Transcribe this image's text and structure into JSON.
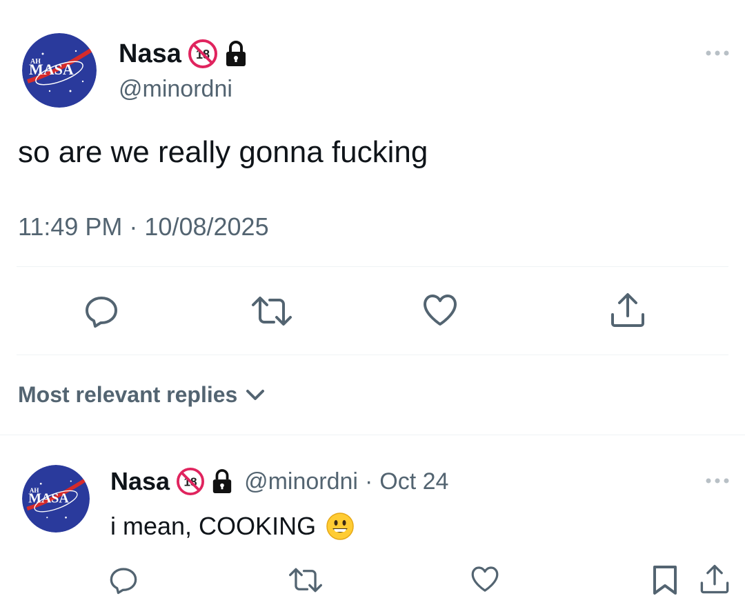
{
  "tweet": {
    "author": {
      "display_name": "Nasa",
      "handle": "@minordni",
      "avatar_text_small": "AH",
      "avatar_text": "MASA",
      "badge_icons": [
        "no-under-18-icon",
        "lock-icon"
      ]
    },
    "text": "so are we really gonna fucking",
    "timestamp": "11:49 PM · 10/08/2025",
    "actions": [
      "reply-icon",
      "retweet-icon",
      "like-icon",
      "share-icon"
    ]
  },
  "replies_header": {
    "label": "Most relevant replies"
  },
  "reply": {
    "author": {
      "display_name": "Nasa",
      "handle": "@minordni",
      "separator": "·",
      "date": "Oct 24",
      "avatar_text_small": "AH",
      "avatar_text": "MASA"
    },
    "text": "i mean, COOKING",
    "emoji": "grinning-face-emoji",
    "actions": [
      "reply-icon",
      "retweet-icon",
      "like-icon",
      "bookmark-icon",
      "share-icon"
    ]
  },
  "colors": {
    "text_primary": "#0f1419",
    "text_secondary": "#536471",
    "divider": "#eff3f4",
    "avatar_blue": "#2a3a9c",
    "nasa_red": "#d62b2b"
  }
}
